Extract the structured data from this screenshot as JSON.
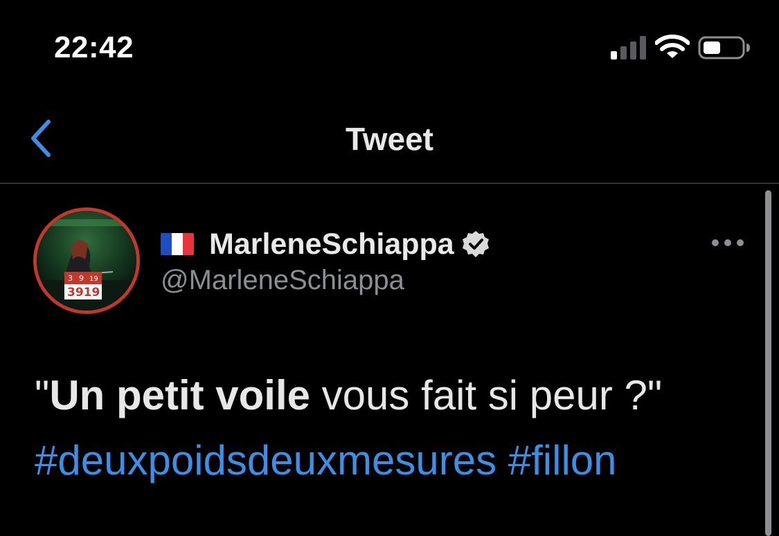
{
  "status_bar": {
    "time": "22:42",
    "signal_icon": "cellular-signal-icon",
    "wifi_icon": "wifi-icon",
    "battery_icon": "battery-icon",
    "battery_level": 0.4
  },
  "nav": {
    "back_icon": "chevron-left-icon",
    "title": "Tweet"
  },
  "tweet": {
    "author": {
      "flag_icon": "france-flag-icon",
      "display_name": "MarleneSchiappa",
      "verified_icon": "verified-badge-icon",
      "handle": "@MarleneSchiappa",
      "avatar_badge_top": [
        "3",
        "9",
        "19"
      ],
      "avatar_badge_number": "3919"
    },
    "more_icon": "more-options-icon",
    "text": {
      "quote_open": "\"",
      "bold": "Un petit voile",
      "rest": " vous fait si peur ?\"",
      "hashtags": [
        "#deuxpoidsdeuxmesures",
        "#fillon"
      ]
    }
  },
  "colors": {
    "background": "#000000",
    "link": "#3d8fe6",
    "secondary_text": "#8b8f94",
    "avatar_ring": "#c0392b"
  }
}
